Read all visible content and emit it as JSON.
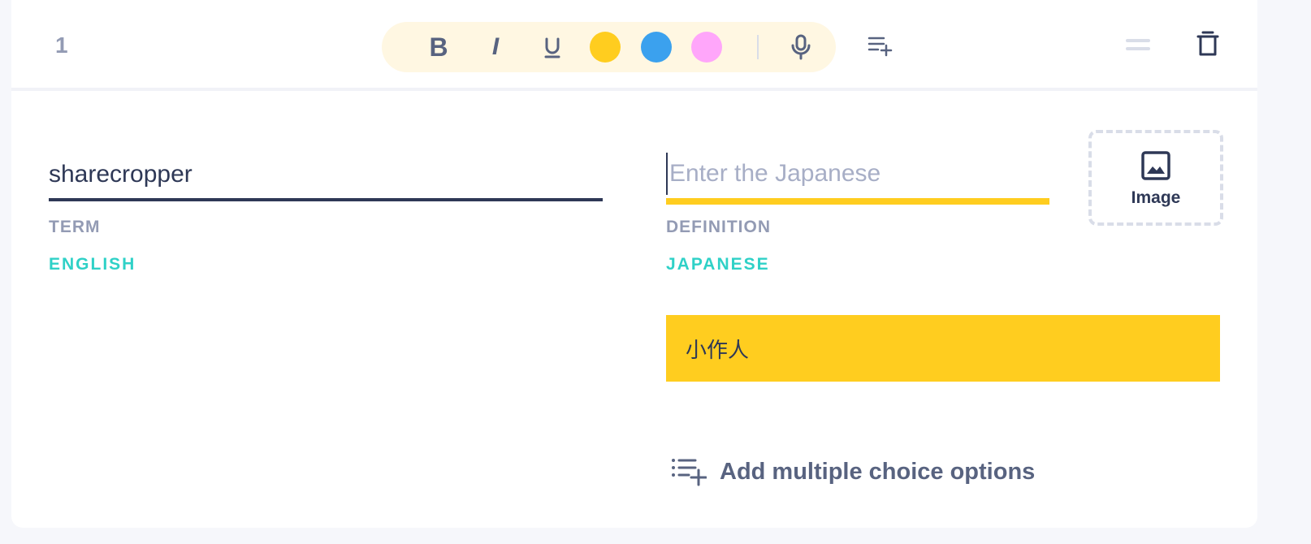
{
  "card": {
    "number": "1"
  },
  "toolbar": {
    "bold_label": "B",
    "italic_label": "I",
    "underline_icon": "underline-icon",
    "colors": {
      "yellow": "#ffcd1f",
      "blue": "#3ba1ee",
      "pink": "#ffa6fa"
    },
    "mic_icon": "microphone-icon"
  },
  "term": {
    "value": "sharecropper",
    "label": "TERM",
    "language": "ENGLISH"
  },
  "definition": {
    "value": "",
    "placeholder": "Enter the Japanese",
    "label": "DEFINITION",
    "language": "JAPANESE"
  },
  "image_button": {
    "label": "Image"
  },
  "suggestion": {
    "text": "小作人"
  },
  "multiple_choice": {
    "label": "Add multiple choice options"
  },
  "accent_colors": {
    "teal": "#2fd1c7",
    "yellow": "#ffcd1f",
    "navy": "#2e3856"
  }
}
